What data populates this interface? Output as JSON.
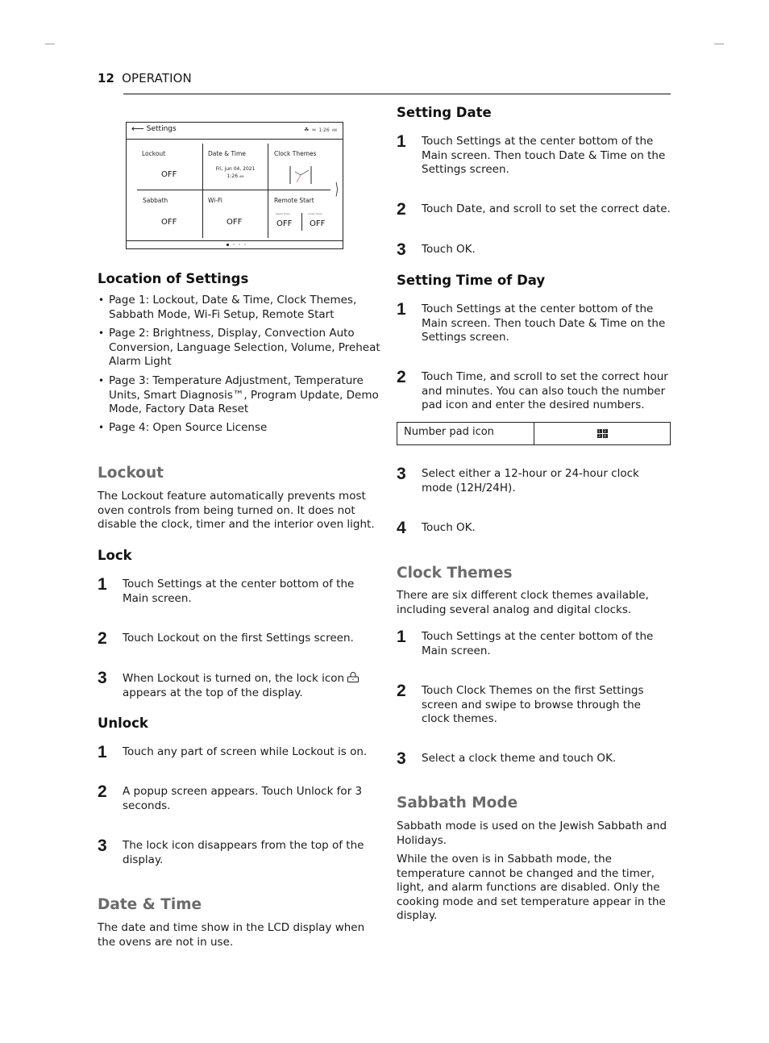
{
  "page": {
    "number": "12",
    "section": "OPERATION"
  },
  "settings_screen": {
    "title": "Settings",
    "status_time": "1:26",
    "status_ampm": "AM",
    "status_icons": [
      "wifi-signal-icon",
      "lock-status-icon"
    ],
    "cells": {
      "lockout": {
        "label": "Lockout",
        "value": "OFF"
      },
      "date_time": {
        "label": "Date & Time",
        "date": "Fri, jun 04, 2021",
        "time": "1:26",
        "ampm": "AM"
      },
      "clock_themes": {
        "label": "Clock Themes"
      },
      "sabbath": {
        "label": "Sabbath",
        "value": "OFF"
      },
      "wifi": {
        "label": "Wi-Fi",
        "value": "OFF"
      },
      "remote_start": {
        "label": "Remote Start",
        "upper_label": "Upper Oven",
        "upper_value": "OFF",
        "lower_label": "Lower Oven",
        "lower_value": "OFF"
      }
    },
    "page_indicator": {
      "current": 1,
      "total": 4
    }
  },
  "left": {
    "location": {
      "heading": "Location of Settings",
      "items": [
        "Page 1: Lockout, Date & Time, Clock Themes, Sabbath Mode, Wi-Fi Setup, Remote Start",
        "Page 2: Brightness, Display, Convection Auto Conversion, Language Selection, Volume, Preheat Alarm Light",
        "Page 3: Temperature Adjustment, Temperature Units, Smart Diagnosis™, Program Update, Demo Mode, Factory Data Reset",
        "Page 4: Open Source License"
      ]
    },
    "lockout": {
      "heading": "Lockout",
      "body": "The Lockout feature automatically prevents most oven controls from being turned on. It does not disable the clock, timer and the interior oven light."
    },
    "lock": {
      "heading": "Lock",
      "steps": [
        {
          "n": "1",
          "text": "Touch Settings at the center bottom of the Main screen."
        },
        {
          "n": "2",
          "text": "Touch Lockout on the first Settings screen."
        },
        {
          "n": "3",
          "text": "When Lockout is turned on, the lock icon",
          "text_after": "appears at the top of the display."
        }
      ]
    },
    "unlock": {
      "heading": "Unlock",
      "steps": [
        {
          "n": "1",
          "text": "Touch any part of screen while Lockout is on."
        },
        {
          "n": "2",
          "text": "A popup screen appears. Touch Unlock for 3 seconds."
        },
        {
          "n": "3",
          "text": "The lock icon disappears from the top of the display."
        }
      ]
    },
    "date_time": {
      "heading": "Date & Time",
      "body": "The date and time show in the LCD display when the ovens are not in use."
    }
  },
  "right": {
    "setting_date": {
      "heading": "Setting Date",
      "steps": [
        {
          "n": "1",
          "text": "Touch Settings at the center bottom of the Main screen. Then touch Date & Time on the Settings screen."
        },
        {
          "n": "2",
          "text": "Touch Date, and scroll to set the correct date."
        },
        {
          "n": "3",
          "text": "Touch OK."
        }
      ]
    },
    "setting_time": {
      "heading": "Setting Time of Day",
      "steps": [
        {
          "n": "1",
          "text": "Touch Settings at the center bottom of the Main screen. Then touch Date & Time on the Settings screen."
        },
        {
          "n": "2",
          "text": "Touch Time, and scroll to set the correct hour and minutes. You can also touch the number pad icon and enter the desired numbers."
        },
        {
          "n": "3",
          "text": "Select either a 12-hour or 24-hour clock mode (12H/24H)."
        },
        {
          "n": "4",
          "text": "Touch OK."
        }
      ],
      "table": {
        "label": "Number pad icon",
        "icon_digits": [
          "1",
          "2",
          "3",
          "4"
        ]
      }
    },
    "clock_themes": {
      "heading": "Clock Themes",
      "body": "There are six different clock themes available, including several analog and digital clocks.",
      "steps": [
        {
          "n": "1",
          "text": "Touch Settings at the center bottom of the Main screen."
        },
        {
          "n": "2",
          "text": "Touch Clock Themes on the first Settings screen and swipe to browse through the clock themes."
        },
        {
          "n": "3",
          "text": "Select a clock theme and touch OK."
        }
      ]
    },
    "sabbath": {
      "heading": "Sabbath Mode",
      "body1": "Sabbath mode is used on the Jewish Sabbath and Holidays.",
      "body2": "While the oven is in Sabbath mode, the temperature cannot be changed and the timer, light, and alarm functions are disabled. Only the cooking mode and set temperature appear in the display."
    }
  },
  "colors": {
    "text": "#1a1a1a",
    "subheading_gray": "#6b6b6b",
    "clock_second_hand": "#e0404a"
  }
}
